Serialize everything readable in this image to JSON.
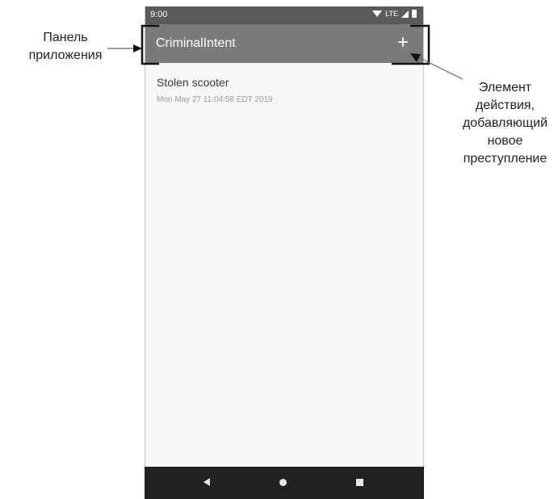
{
  "status_bar": {
    "time": "9:00",
    "network": "LTE"
  },
  "app_bar": {
    "title": "CriminalIntent",
    "add_button_label": "+"
  },
  "crimes": [
    {
      "title": "Stolen scooter",
      "date": "Mon May 27 11:04:58 EDT 2019"
    }
  ],
  "annotations": {
    "app_bar_label_line1": "Панель",
    "app_bar_label_line2": "приложения",
    "action_label_line1": "Элемент",
    "action_label_line2": "действия,",
    "action_label_line3": "добавляющий",
    "action_label_line4": "новое",
    "action_label_line5": "преступление"
  },
  "nav_bar": {
    "buttons": [
      "back",
      "home",
      "recents"
    ]
  }
}
